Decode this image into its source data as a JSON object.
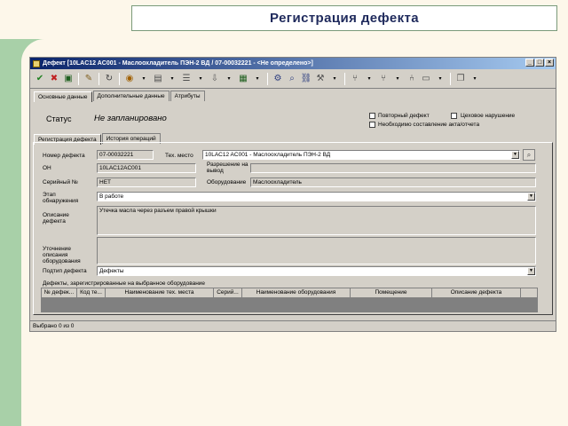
{
  "slide": {
    "title": "Регистрация дефекта"
  },
  "window": {
    "title": "Дефект [10LAC12 AC001 - Маслоохладитель ПЭН-2 ВД / 07-00032221 - <Не определено>]",
    "buttons": [
      "_",
      "□",
      "×"
    ]
  },
  "tabs": {
    "main": [
      "Основные данные",
      "Дополнительные данные",
      "Атрибуты"
    ],
    "sub": [
      "Регистрация дефекта",
      "История операций"
    ]
  },
  "status": {
    "label": "Статус",
    "value": "Не запланировано"
  },
  "checkboxes": {
    "repeat": "Повторный дефект",
    "shop_violation": "Цеховое нарушение",
    "act_required": "Необходимо составление акта/отчета"
  },
  "form": {
    "defect_number_label": "Номер дефекта",
    "defect_number": "07-00032221",
    "tech_place_label": "Тех. место",
    "tech_place": "10LAC12 AC001 - Маслоохладитель ПЭН-2 ВД",
    "oh_label": "ОН",
    "oh": "10LAC12AC001",
    "permit_label": "Разрешение на вывод",
    "permit": "",
    "serial_label": "Серийный №",
    "serial": "НЕТ",
    "equipment_label": "Оборудование",
    "equipment": "Маслоохладитель",
    "stage_label": "Этап обнаружения",
    "stage": "В работе",
    "description_label": "Описание дефекта",
    "description": "Утечка масла через разъем правой крышки",
    "clarify_label": "Уточнение описания оборудования",
    "clarify": "",
    "subtype_label": "Подтип дефекта",
    "subtype": "Дефекты"
  },
  "table": {
    "caption": "Дефекты, зарегистрированные на выбранное оборудование",
    "columns": [
      "№ дефек...",
      "Код те...",
      "Наименование тех. места",
      "Серий...",
      "Наименование оборудования",
      "Помещение",
      "Описание дефекта"
    ]
  },
  "statusbar": {
    "text": "Выбрано 0 из 0"
  },
  "colors": {
    "title_text": "#1f2a5c",
    "green": "#a8d0a8",
    "window_title": "#0a246a"
  }
}
